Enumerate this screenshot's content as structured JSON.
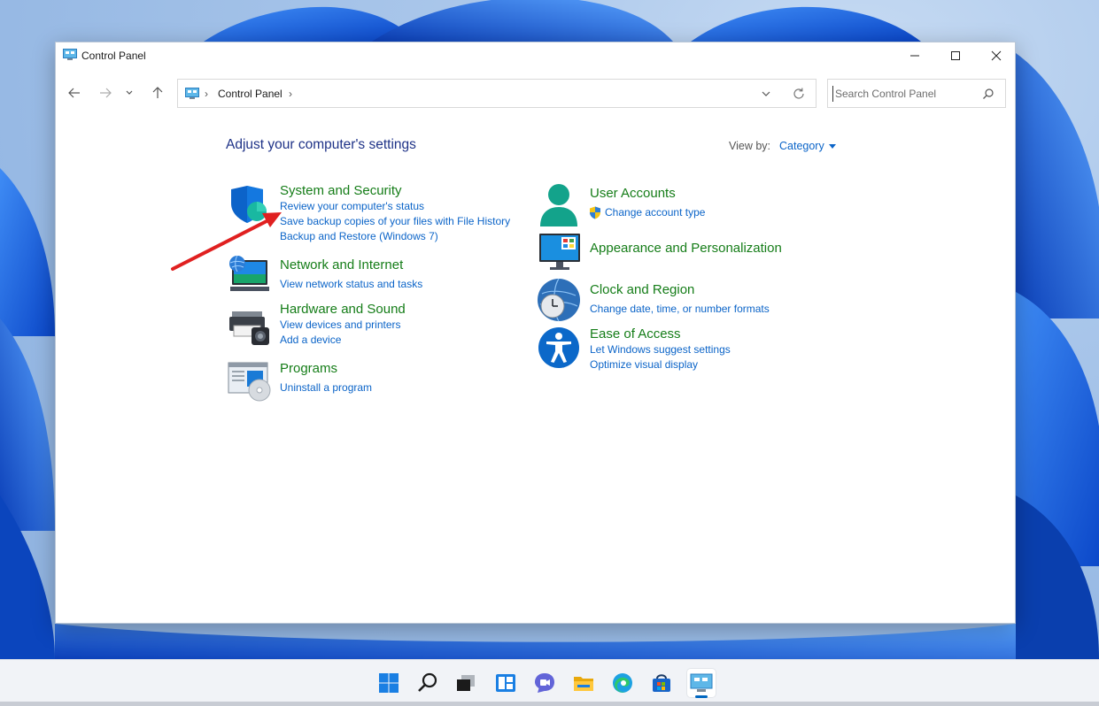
{
  "window": {
    "title": "Control Panel"
  },
  "navigation": {
    "breadcrumb_root": "Control Panel",
    "separator": "›"
  },
  "search": {
    "placeholder": "Search Control Panel"
  },
  "content": {
    "heading": "Adjust your computer's settings",
    "view_by_label": "View by:",
    "view_by_value": "Category"
  },
  "categories": {
    "system_security": {
      "title": "System and Security",
      "links": [
        "Review your computer's status",
        "Save backup copies of your files with File History",
        "Backup and Restore (Windows 7)"
      ]
    },
    "network_internet": {
      "title": "Network and Internet",
      "links": [
        "View network status and tasks"
      ]
    },
    "hardware_sound": {
      "title": "Hardware and Sound",
      "links": [
        "View devices and printers",
        "Add a device"
      ]
    },
    "programs": {
      "title": "Programs",
      "links": [
        "Uninstall a program"
      ]
    },
    "user_accounts": {
      "title": "User Accounts",
      "links": [
        "Change account type"
      ]
    },
    "appearance": {
      "title": "Appearance and Personalization",
      "links": []
    },
    "clock_region": {
      "title": "Clock and Region",
      "links": [
        "Change date, time, or number formats"
      ]
    },
    "ease_access": {
      "title": "Ease of Access",
      "links": [
        "Let Windows suggest settings",
        "Optimize visual display"
      ]
    }
  },
  "taskbar": {
    "icons": [
      "windows-start-icon",
      "search-icon",
      "task-view-icon",
      "widgets-icon",
      "teams-chat-icon",
      "file-explorer-icon",
      "edge-icon",
      "store-icon",
      "control-panel-icon"
    ],
    "active": "control-panel-icon"
  },
  "colors": {
    "title_green": "#157d18",
    "link_blue": "#0b64c8",
    "heading_blue": "#1e3287",
    "annotation_red": "#e02020"
  }
}
